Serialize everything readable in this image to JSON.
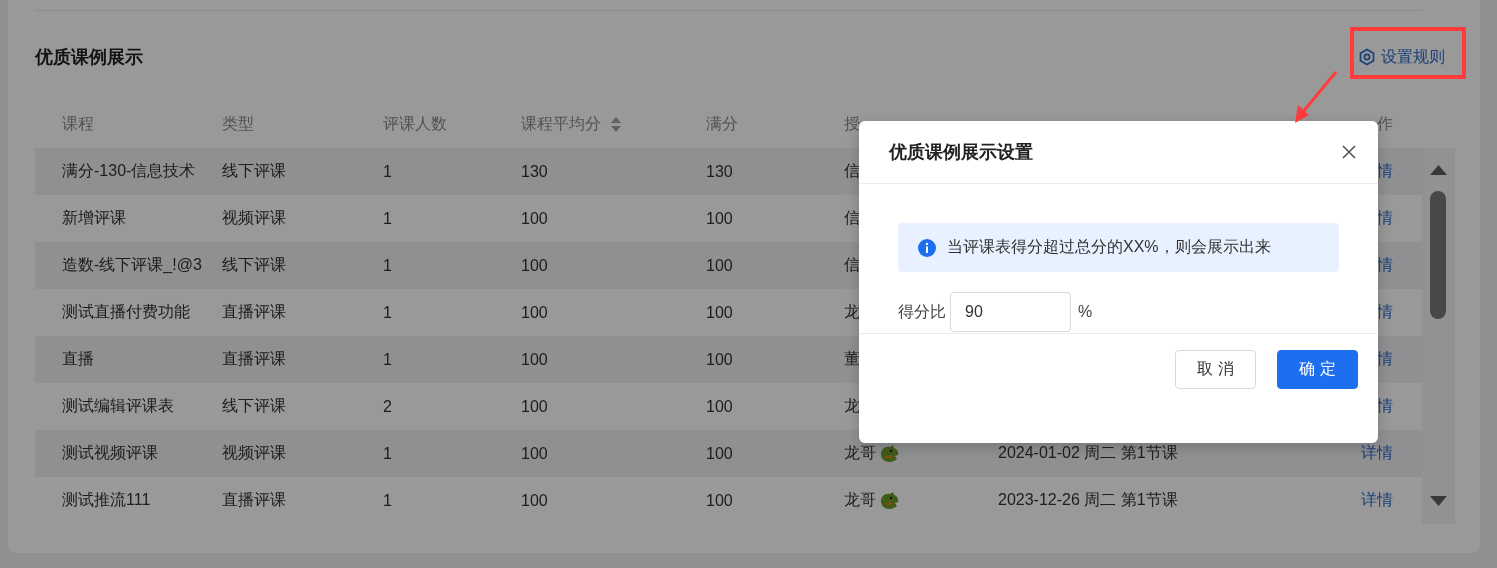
{
  "section": {
    "title": "优质课例展示",
    "rule_link": "设置规则"
  },
  "table": {
    "columns": [
      {
        "label": "课程",
        "sortable": false
      },
      {
        "label": "类型",
        "sortable": false
      },
      {
        "label": "评课人数",
        "sortable": false
      },
      {
        "label": "课程平均分",
        "sortable": true
      },
      {
        "label": "满分",
        "sortable": false
      },
      {
        "label": "授",
        "sortable": false
      },
      {
        "label": "作",
        "sortable": false
      }
    ],
    "rows": [
      {
        "course": "满分-130-信息技术",
        "type": "线下评课",
        "raters": "1",
        "average": "130",
        "full": "130",
        "teacher": "信",
        "badge": false,
        "action": "情"
      },
      {
        "course": "新增评课",
        "type": "视频评课",
        "raters": "1",
        "average": "100",
        "full": "100",
        "teacher": "信",
        "badge": false,
        "action": "情"
      },
      {
        "course": "造数-线下评课_!@3",
        "type": "线下评课",
        "raters": "1",
        "average": "100",
        "full": "100",
        "teacher": "信",
        "badge": false,
        "action": "情"
      },
      {
        "course": "测试直播付费功能",
        "type": "直播评课",
        "raters": "1",
        "average": "100",
        "full": "100",
        "teacher": "龙",
        "badge": false,
        "action": "情"
      },
      {
        "course": "直播",
        "type": "直播评课",
        "raters": "1",
        "average": "100",
        "full": "100",
        "teacher": "董",
        "badge": false,
        "action": "情"
      },
      {
        "course": "测试编辑评课表",
        "type": "线下评课",
        "raters": "2",
        "average": "100",
        "full": "100",
        "teacher": "龙",
        "badge": false,
        "action": "情"
      },
      {
        "course": "测试视频评课",
        "type": "视频评课",
        "raters": "1",
        "average": "100",
        "full": "100",
        "teacher": "龙哥",
        "badge": true,
        "time": "2024-01-02 周二 第1节课",
        "action": "详情"
      },
      {
        "course": "测试推流111",
        "type": "直播评课",
        "raters": "1",
        "average": "100",
        "full": "100",
        "teacher": "龙哥",
        "badge": true,
        "time": "2023-12-26 周二 第1节课",
        "action": "详情"
      }
    ]
  },
  "dialog": {
    "title": "优质课例展示设置",
    "notice": "当评课表得分超过总分的XX%，则会展示出来",
    "field_label": "得分比",
    "field_value": "90",
    "unit": "%",
    "buttons": [
      {
        "label": "取 消",
        "kind": "secondary"
      },
      {
        "label": "确 定",
        "kind": "primary"
      }
    ]
  }
}
